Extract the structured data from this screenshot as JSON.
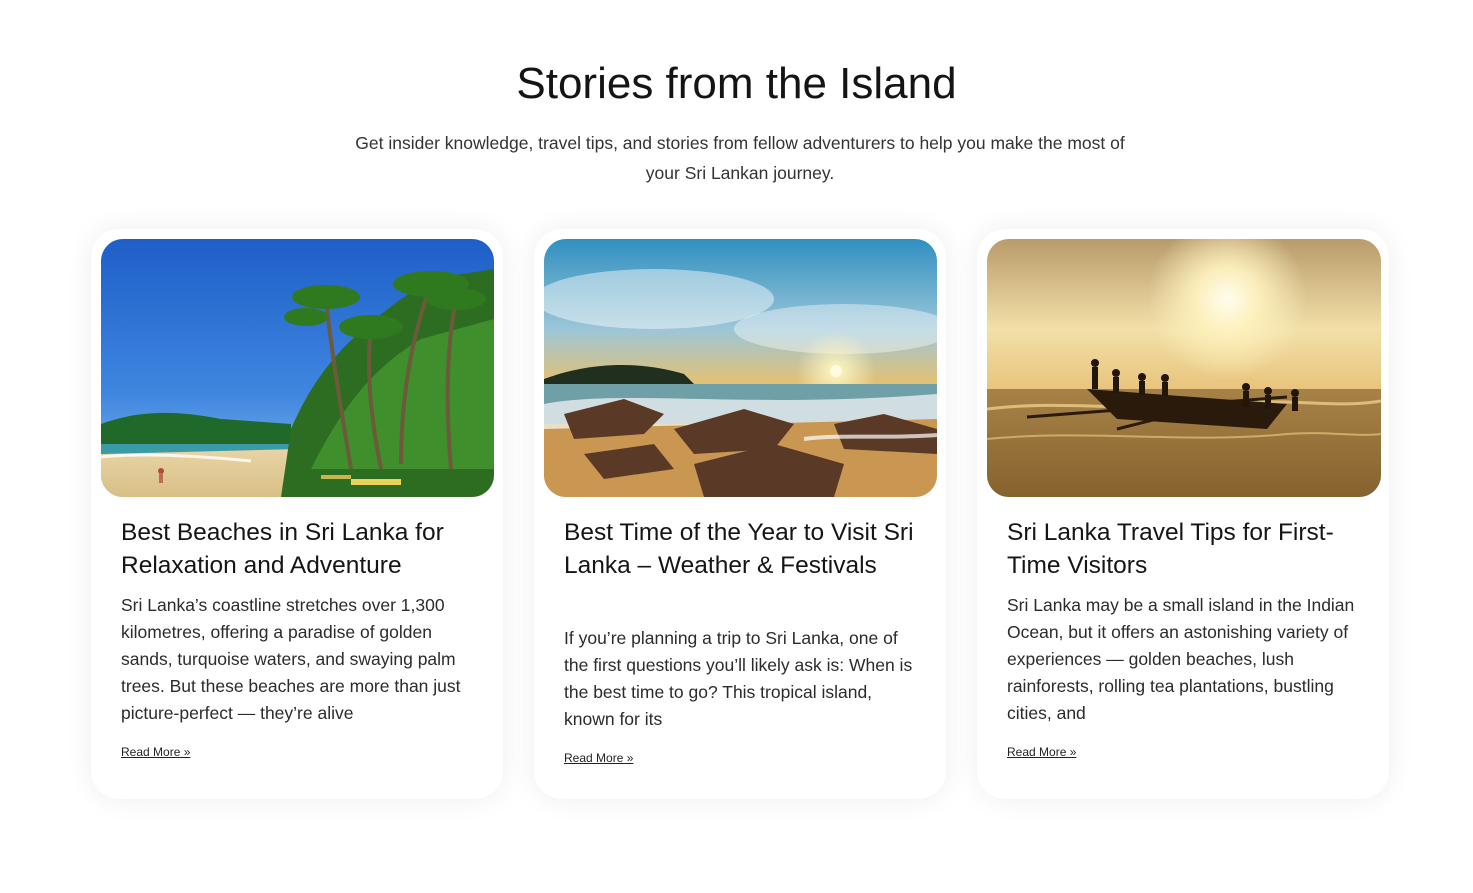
{
  "section": {
    "title": "Stories from the Island",
    "subtitle": "Get insider knowledge, travel tips, and stories from fellow adventurers to help you make the most of your Sri Lankan journey."
  },
  "cards": [
    {
      "title": "Best Beaches in Sri Lanka for Relaxation and Adventure",
      "excerpt": "Sri Lanka’s coastline stretches over 1,300 kilometres, offering a paradise of golden sands, turquoise waters, and swaying palm trees. But these beaches are more than just picture-perfect — they’re alive",
      "link": "Read More »",
      "image": "palm-beach-photo"
    },
    {
      "title": "Best Time of the Year to Visit Sri Lanka – Weather & Festivals",
      "excerpt": "If you’re planning a trip to Sri Lanka, one of the first questions you’ll likely ask is: When is the best time to go? This tropical island, known for its",
      "link": "Read More »",
      "image": "rocky-beach-sunset-photo"
    },
    {
      "title": "Sri Lanka Travel Tips for First-Time Visitors",
      "excerpt": "Sri Lanka may be a small island in the Indian Ocean, but it offers an astonishing variety of experiences — golden beaches, lush rainforests, rolling tea plantations, bustling cities, and",
      "link": "Read More »",
      "image": "fishermen-boat-sunset-photo"
    }
  ],
  "colors": {
    "background": "#ffffff",
    "text": "#1f1f1f",
    "card_shadow": "rgba(0,0,0,0.07)"
  }
}
